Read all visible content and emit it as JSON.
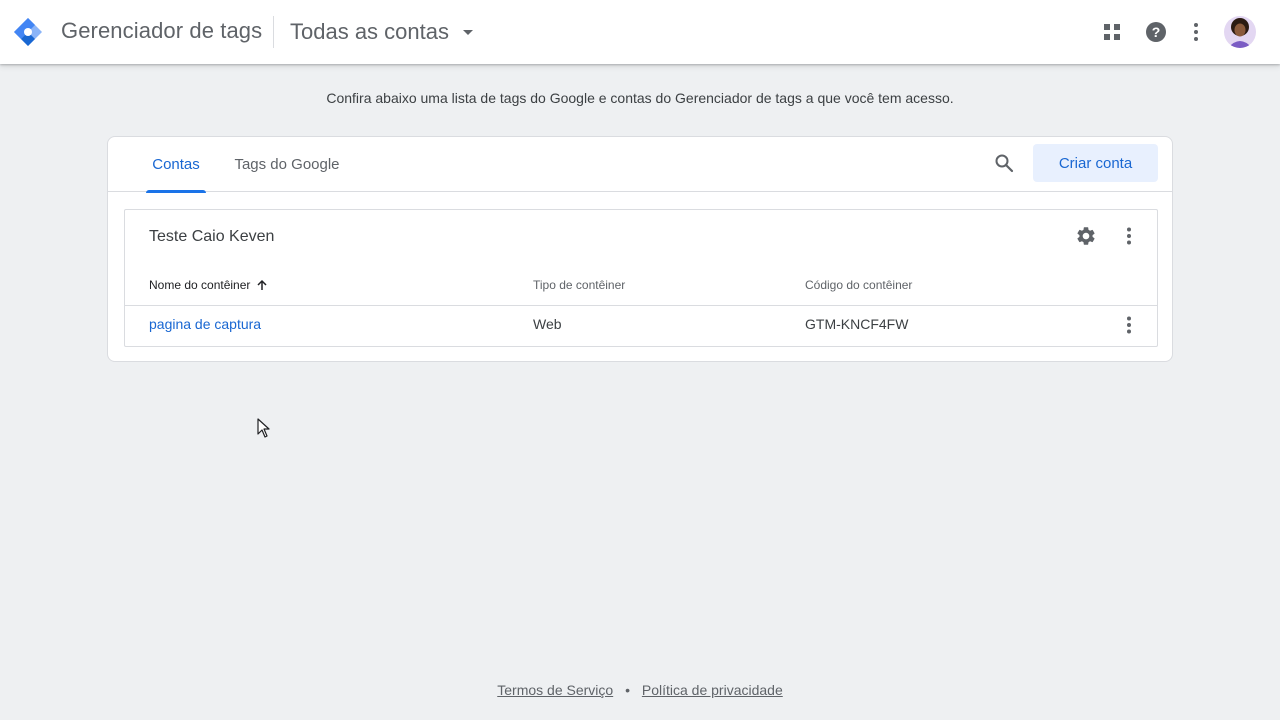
{
  "header": {
    "product_name": "Gerenciador de tags",
    "account_switcher": "Todas as contas",
    "icons": [
      "gtm-logo-icon",
      "apps-icon",
      "help-icon",
      "more-vert-icon",
      "avatar"
    ]
  },
  "intro_text": "Confira abaixo uma lista de tags do Google e contas do Gerenciador de tags a que você tem acesso.",
  "main": {
    "tabs": [
      {
        "label": "Contas",
        "active": true
      },
      {
        "label": "Tags do Google",
        "active": false
      }
    ],
    "create_button": "Criar conta",
    "account": {
      "name": "Teste Caio Keven",
      "columns": [
        "Nome do contêiner",
        "Tipo de contêiner",
        "Código do contêiner"
      ],
      "rows": [
        {
          "name": "pagina de captura",
          "type": "Web",
          "code": "GTM-KNCF4FW"
        }
      ]
    }
  },
  "footer": {
    "terms": "Termos de Serviço",
    "separator": "•",
    "privacy": "Política de privacidade"
  },
  "colors": {
    "accent": "#1a73e8",
    "link": "#1967d2",
    "background": "#eef0f2",
    "create_button_bg": "#e8f0fe"
  }
}
